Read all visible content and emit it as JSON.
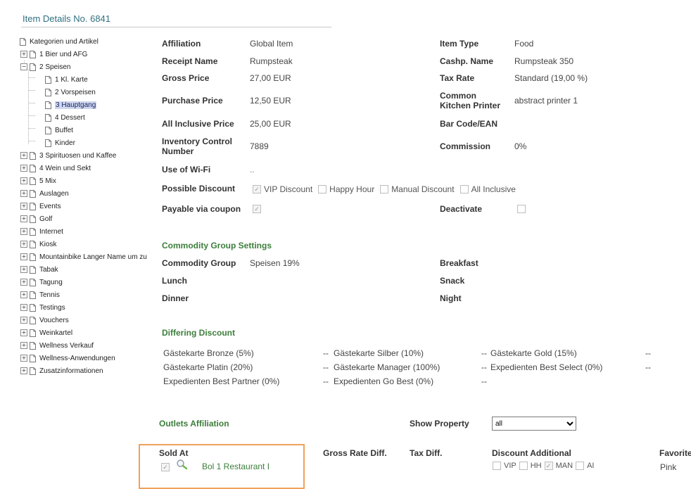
{
  "header": {
    "title": "Item Details No. 6841"
  },
  "tree": {
    "root": "Kategorien und Artikel",
    "items": [
      "1 Bier und AFG",
      "2 Speisen",
      "1 Kl. Karte",
      "2 Vorspeisen",
      "3 Hauptgang",
      "4 Dessert",
      "Buffet",
      "Kinder",
      "3 Spirituosen und Kaffee",
      "4 Wein und Sekt",
      "5 Mix",
      "Auslagen",
      "Events",
      "Golf",
      "Internet",
      "Kiosk",
      "Mountainbike Langer Name um zu",
      "Tabak",
      "Tagung",
      "Tennis",
      "Testings",
      "Vouchers",
      "Weinkartel",
      "Wellness Verkauf",
      "Wellness-Anwendungen",
      "Zusatzinformationen"
    ],
    "expand_symbol": "+",
    "collapse_symbol": "−"
  },
  "details": {
    "affiliation_label": "Affiliation",
    "affiliation_value": "Global Item",
    "receipt_name_label": "Receipt Name",
    "receipt_name_value": "Rumpsteak",
    "gross_price_label": "Gross Price",
    "gross_price_value": "27,00 EUR",
    "purchase_price_label": "Purchase Price",
    "purchase_price_value": "12,50 EUR",
    "all_inclusive_price_label": "All Inclusive Price",
    "all_inclusive_price_value": "25,00 EUR",
    "inventory_label_line1": "Inventory Control",
    "inventory_label_line2": "Number",
    "inventory_value": "7889",
    "wifi_label": "Use of Wi-Fi",
    "wifi_value": "..",
    "possible_discount_label": "Possible Discount",
    "discounts": [
      {
        "label": "VIP Discount",
        "checked": true
      },
      {
        "label": "Happy Hour",
        "checked": false
      },
      {
        "label": "Manual Discount",
        "checked": false
      },
      {
        "label": "All Inclusive",
        "checked": false
      }
    ],
    "payable_coupon_label": "Payable via coupon",
    "payable_coupon_checked": true,
    "item_type_label": "Item Type",
    "item_type_value": "Food",
    "cashp_name_label": "Cashp. Name",
    "cashp_name_value": "Rumpsteak 350",
    "tax_rate_label": "Tax Rate",
    "tax_rate_value": "Standard (19,00 %)",
    "common_label_line1": "Common",
    "common_label_line2": "Kitchen Printer",
    "common_value": "abstract printer 1",
    "barcode_label": "Bar Code/EAN",
    "commission_label": "Commission",
    "commission_value": "0%",
    "deactivate_label": "Deactivate",
    "deactivate_checked": false,
    "check_mark": "✓"
  },
  "commodity": {
    "section_title": "Commodity Group Settings",
    "group_label": "Commodity Group",
    "group_value": "Speisen 19%",
    "breakfast_label": "Breakfast",
    "lunch_label": "Lunch",
    "snack_label": "Snack",
    "dinner_label": "Dinner",
    "night_label": "Night"
  },
  "differing_discount": {
    "section_title": "Differing Discount",
    "rows": [
      [
        "Gästekarte Bronze (5%)",
        "--",
        "Gästekarte Silber (10%)",
        "--",
        "Gästekarte Gold (15%)",
        "--"
      ],
      [
        "Gästekarte Platin (20%)",
        "--",
        "Gästekarte Manager (100%)",
        "--",
        "Expedienten Best Select (0%)",
        "--"
      ],
      [
        "Expedienten Best Partner (0%)",
        "--",
        "Expedienten Go Best (0%)",
        "--"
      ]
    ]
  },
  "outlets": {
    "section_title": "Outlets Affiliation",
    "show_property_label": "Show Property",
    "show_property_value": "all",
    "columns": {
      "sold_at": "Sold At",
      "gross_rate_diff": "Gross Rate Diff.",
      "tax_diff": "Tax Diff.",
      "discount_additional": "Discount Additional",
      "favorite": "Favorite"
    },
    "row": {
      "name": "Bol 1 Restaurant I",
      "sold": true,
      "discounts": [
        {
          "label": "VIP",
          "checked": false
        },
        {
          "label": "HH",
          "checked": false
        },
        {
          "label": "MAN",
          "checked": true
        },
        {
          "label": "AI",
          "checked": false
        }
      ],
      "favorite": "Pink"
    }
  }
}
